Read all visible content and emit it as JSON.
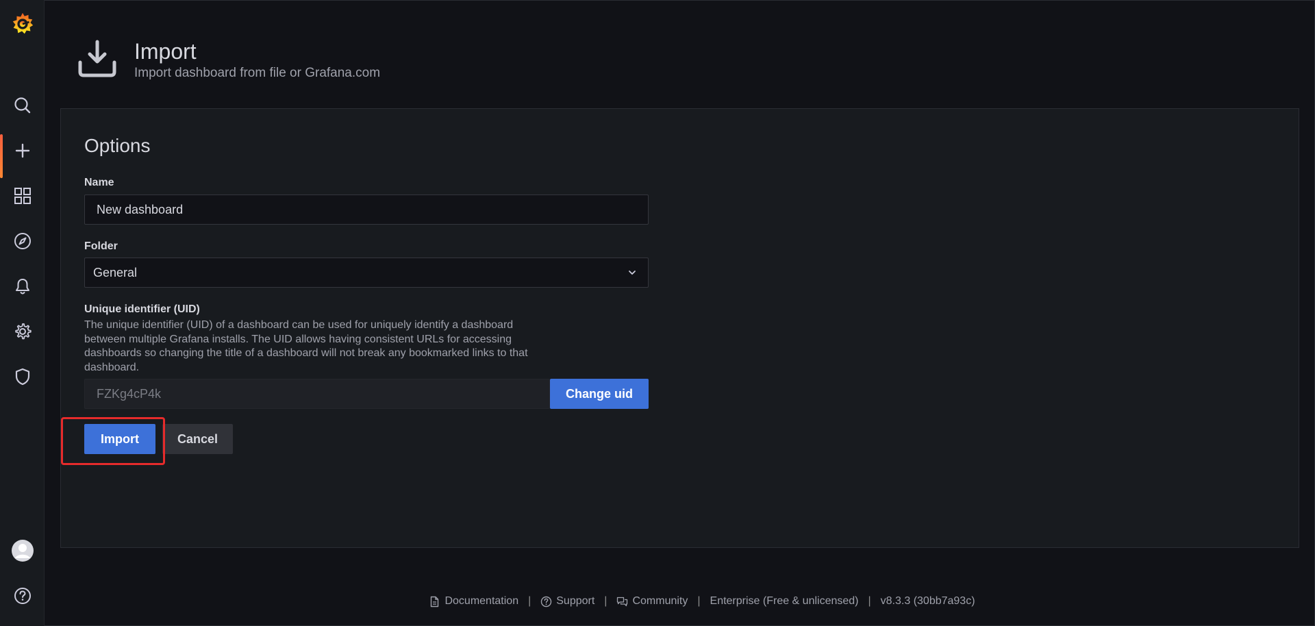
{
  "header": {
    "title": "Import",
    "subtitle": "Import dashboard from file or Grafana.com"
  },
  "sidebar": {
    "items": [
      {
        "icon": "grafana-logo-icon"
      },
      {
        "icon": "search-icon"
      },
      {
        "icon": "plus-icon",
        "active": true
      },
      {
        "icon": "dashboards-grid-icon"
      },
      {
        "icon": "explore-compass-icon"
      },
      {
        "icon": "alerting-bell-icon"
      },
      {
        "icon": "configuration-gear-icon"
      },
      {
        "icon": "server-admin-shield-icon"
      },
      {
        "icon": "user-avatar-icon"
      },
      {
        "icon": "help-icon"
      }
    ]
  },
  "form": {
    "section_title": "Options",
    "name_label": "Name",
    "name_value": "New dashboard",
    "folder_label": "Folder",
    "folder_value": "General",
    "uid_label": "Unique identifier (UID)",
    "uid_description": "The unique identifier (UID) of a dashboard can be used for uniquely identify a dashboard between multiple Grafana installs. The UID allows having consistent URLs for accessing dashboards so changing the title of a dashboard will not break any bookmarked links to that dashboard.",
    "uid_value": "FZKg4cP4k",
    "change_uid_label": "Change uid",
    "import_label": "Import",
    "cancel_label": "Cancel"
  },
  "footer": {
    "documentation": "Documentation",
    "support": "Support",
    "community": "Community",
    "edition": "Enterprise (Free & unlicensed)",
    "version": "v8.3.3 (30bb7a93c)",
    "separator": "|"
  },
  "colors": {
    "background": "#111217",
    "panel": "#181b1f",
    "primary": "#3d71d9",
    "highlight": "#e52b2b"
  }
}
